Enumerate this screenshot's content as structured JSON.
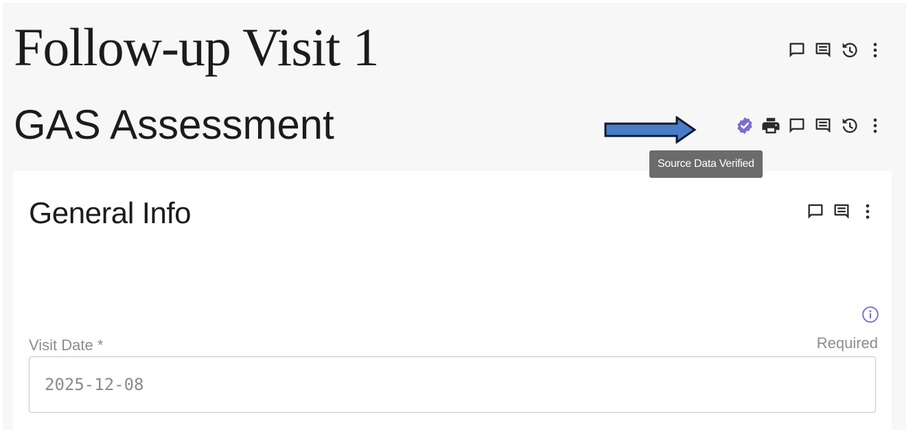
{
  "visit": {
    "title": "Follow-up Visit 1"
  },
  "form": {
    "title": "GAS Assessment",
    "tooltip": "Source Data Verified"
  },
  "section": {
    "title": "General Info",
    "fields": [
      {
        "label": "Visit Date *",
        "status": "Required",
        "value": "2025-12-08"
      }
    ]
  },
  "icons": {
    "visit_actions": [
      "comment-outline-icon",
      "comment-list-icon",
      "history-icon",
      "more-vertical-icon"
    ],
    "form_actions": [
      "source-data-verified-icon",
      "print-icon",
      "comment-outline-icon",
      "comment-list-icon",
      "history-icon",
      "more-vertical-icon"
    ],
    "section_actions": [
      "comment-outline-icon",
      "comment-list-icon",
      "more-vertical-icon"
    ],
    "field_info": "info-icon",
    "annotation": "arrow-icon"
  },
  "colors": {
    "page_background": "#f7f7f7",
    "card_background": "#ffffff",
    "verified_accent": "#7a6fd0",
    "info_accent": "#7a6fd0",
    "arrow_fill": "#4a7bc7",
    "arrow_stroke": "#0d1b2e",
    "tooltip_background": "#6b6b6b",
    "icon_color": "#2b2b2b"
  }
}
